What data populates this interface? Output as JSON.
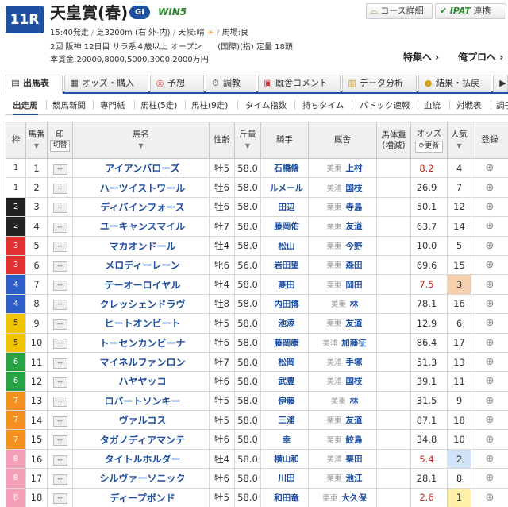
{
  "header": {
    "race_no": "11R",
    "race_name": "天皇賞(春)",
    "grade": "GI",
    "win5": "WIN5",
    "course_btn": "コース詳細",
    "ipat_btn_mark": "IPAT",
    "ipat_btn_label": "連携",
    "start_time": "15:40発走",
    "course": "芝3200m (右 外-内)",
    "weather_label": "天候:晴",
    "track_label": "馬場:良",
    "info_line2": "2回 阪神 12日目 サラ系４歳以上 オープン　　(国際)(指) 定量 18頭",
    "prize": "本賞金:20000,8000,5000,3000,2000万円",
    "special_link": "特集へ",
    "pro_link": "俺プロへ"
  },
  "tabs": [
    {
      "label": "出馬表",
      "icon": "card-list-icon",
      "active": true
    },
    {
      "label": "オッズ・購入",
      "icon": "odds-icon",
      "active": false
    },
    {
      "label": "予想",
      "icon": "target-icon",
      "active": false
    },
    {
      "label": "調教",
      "icon": "stopwatch-icon",
      "active": false
    },
    {
      "label": "厩舎コメント",
      "icon": "comment-icon",
      "active": false
    },
    {
      "label": "データ分析",
      "icon": "chart-icon",
      "active": false
    },
    {
      "label": "結果・払戻",
      "icon": "coins-icon",
      "active": false
    }
  ],
  "subnav": [
    "出走馬",
    "競馬新聞",
    "専門紙",
    "馬柱(5走)",
    "馬柱(9走)",
    "タイム指数",
    "持ちタイム",
    "パドック速報",
    "血統",
    "対戦表",
    "調子"
  ],
  "columns": {
    "waku": "枠",
    "umaban": "馬番",
    "mark": "印",
    "kiri": "切替",
    "horse": "馬名",
    "sex_age": "性齢",
    "weight": "斤量",
    "jockey": "騎手",
    "stable": "厩舎",
    "body_weight": "馬体重",
    "body_weight_sub": "(増減)",
    "odds": "オッズ",
    "odds_refresh": "更新",
    "popularity": "人気",
    "register": "登録"
  },
  "mark_value": "--",
  "colors": {
    "waku": {
      "1": "#ffffff",
      "2": "#222222",
      "3": "#e03030",
      "4": "#2f5fc8",
      "5": "#f2c400",
      "6": "#27a545",
      "7": "#f39020",
      "8": "#f4a0b8"
    },
    "accent": "#1f4fa0"
  },
  "horses": [
    {
      "waku": "1",
      "umaban": "1",
      "name": "アイアンバローズ",
      "sex_age": "牡5",
      "weight": "58.0",
      "jockey": "石橋脩",
      "region": "美東",
      "trainer": "上村",
      "odds": "8.2",
      "pop": "4"
    },
    {
      "waku": "1",
      "umaban": "2",
      "name": "ハーツイストワール",
      "sex_age": "牡6",
      "weight": "58.0",
      "jockey": "ルメール",
      "region": "美浦",
      "trainer": "国枝",
      "odds": "26.9",
      "pop": "7"
    },
    {
      "waku": "2",
      "umaban": "3",
      "name": "ディバインフォース",
      "sex_age": "牡6",
      "weight": "58.0",
      "jockey": "田辺",
      "region": "栗東",
      "trainer": "寺島",
      "odds": "50.1",
      "pop": "12"
    },
    {
      "waku": "2",
      "umaban": "4",
      "name": "ユーキャンスマイル",
      "sex_age": "牡7",
      "weight": "58.0",
      "jockey": "藤岡佑",
      "region": "栗東",
      "trainer": "友道",
      "odds": "63.7",
      "pop": "14"
    },
    {
      "waku": "3",
      "umaban": "5",
      "name": "マカオンドール",
      "sex_age": "牡4",
      "weight": "58.0",
      "jockey": "松山",
      "region": "栗東",
      "trainer": "今野",
      "odds": "10.0",
      "pop": "5"
    },
    {
      "waku": "3",
      "umaban": "6",
      "name": "メロディーレーン",
      "sex_age": "牝6",
      "weight": "56.0",
      "jockey": "岩田望",
      "region": "栗東",
      "trainer": "森田",
      "odds": "69.6",
      "pop": "15"
    },
    {
      "waku": "4",
      "umaban": "7",
      "name": "テーオーロイヤル",
      "sex_age": "牡4",
      "weight": "58.0",
      "jockey": "菱田",
      "region": "栗東",
      "trainer": "岡田",
      "odds": "7.5",
      "pop": "3"
    },
    {
      "waku": "4",
      "umaban": "8",
      "name": "クレッシェンドラヴ",
      "sex_age": "牡8",
      "weight": "58.0",
      "jockey": "内田博",
      "region": "美東",
      "trainer": "林",
      "odds": "78.1",
      "pop": "16"
    },
    {
      "waku": "5",
      "umaban": "9",
      "name": "ヒートオンビート",
      "sex_age": "牡5",
      "weight": "58.0",
      "jockey": "池添",
      "region": "栗東",
      "trainer": "友道",
      "odds": "12.9",
      "pop": "6"
    },
    {
      "waku": "5",
      "umaban": "10",
      "name": "トーセンカンビーナ",
      "sex_age": "牡6",
      "weight": "58.0",
      "jockey": "藤岡康",
      "region": "美浦",
      "trainer": "加藤征",
      "odds": "86.4",
      "pop": "17"
    },
    {
      "waku": "6",
      "umaban": "11",
      "name": "マイネルファンロン",
      "sex_age": "牡7",
      "weight": "58.0",
      "jockey": "松岡",
      "region": "美浦",
      "trainer": "手塚",
      "odds": "51.3",
      "pop": "13"
    },
    {
      "waku": "6",
      "umaban": "12",
      "name": "ハヤヤッコ",
      "sex_age": "牡6",
      "weight": "58.0",
      "jockey": "武豊",
      "region": "美浦",
      "trainer": "国枝",
      "odds": "39.1",
      "pop": "11"
    },
    {
      "waku": "7",
      "umaban": "13",
      "name": "ロバートソンキー",
      "sex_age": "牡5",
      "weight": "58.0",
      "jockey": "伊藤",
      "region": "美東",
      "trainer": "林",
      "odds": "31.5",
      "pop": "9"
    },
    {
      "waku": "7",
      "umaban": "14",
      "name": "ヴァルコス",
      "sex_age": "牡5",
      "weight": "58.0",
      "jockey": "三浦",
      "region": "栗東",
      "trainer": "友道",
      "odds": "87.1",
      "pop": "18"
    },
    {
      "waku": "7",
      "umaban": "15",
      "name": "タガノディアマンテ",
      "sex_age": "牡6",
      "weight": "58.0",
      "jockey": "幸",
      "region": "栗東",
      "trainer": "鮫島",
      "odds": "34.8",
      "pop": "10"
    },
    {
      "waku": "8",
      "umaban": "16",
      "name": "タイトルホルダー",
      "sex_age": "牡4",
      "weight": "58.0",
      "jockey": "横山和",
      "region": "美浦",
      "trainer": "栗田",
      "odds": "5.4",
      "pop": "2"
    },
    {
      "waku": "8",
      "umaban": "17",
      "name": "シルヴァーソニック",
      "sex_age": "牡6",
      "weight": "58.0",
      "jockey": "川田",
      "region": "栗東",
      "trainer": "池江",
      "odds": "28.1",
      "pop": "8"
    },
    {
      "waku": "8",
      "umaban": "18",
      "name": "ディープボンド",
      "sex_age": "牡5",
      "weight": "58.0",
      "jockey": "和田竜",
      "region": "栗東",
      "trainer": "大久保",
      "odds": "2.6",
      "pop": "1"
    }
  ]
}
